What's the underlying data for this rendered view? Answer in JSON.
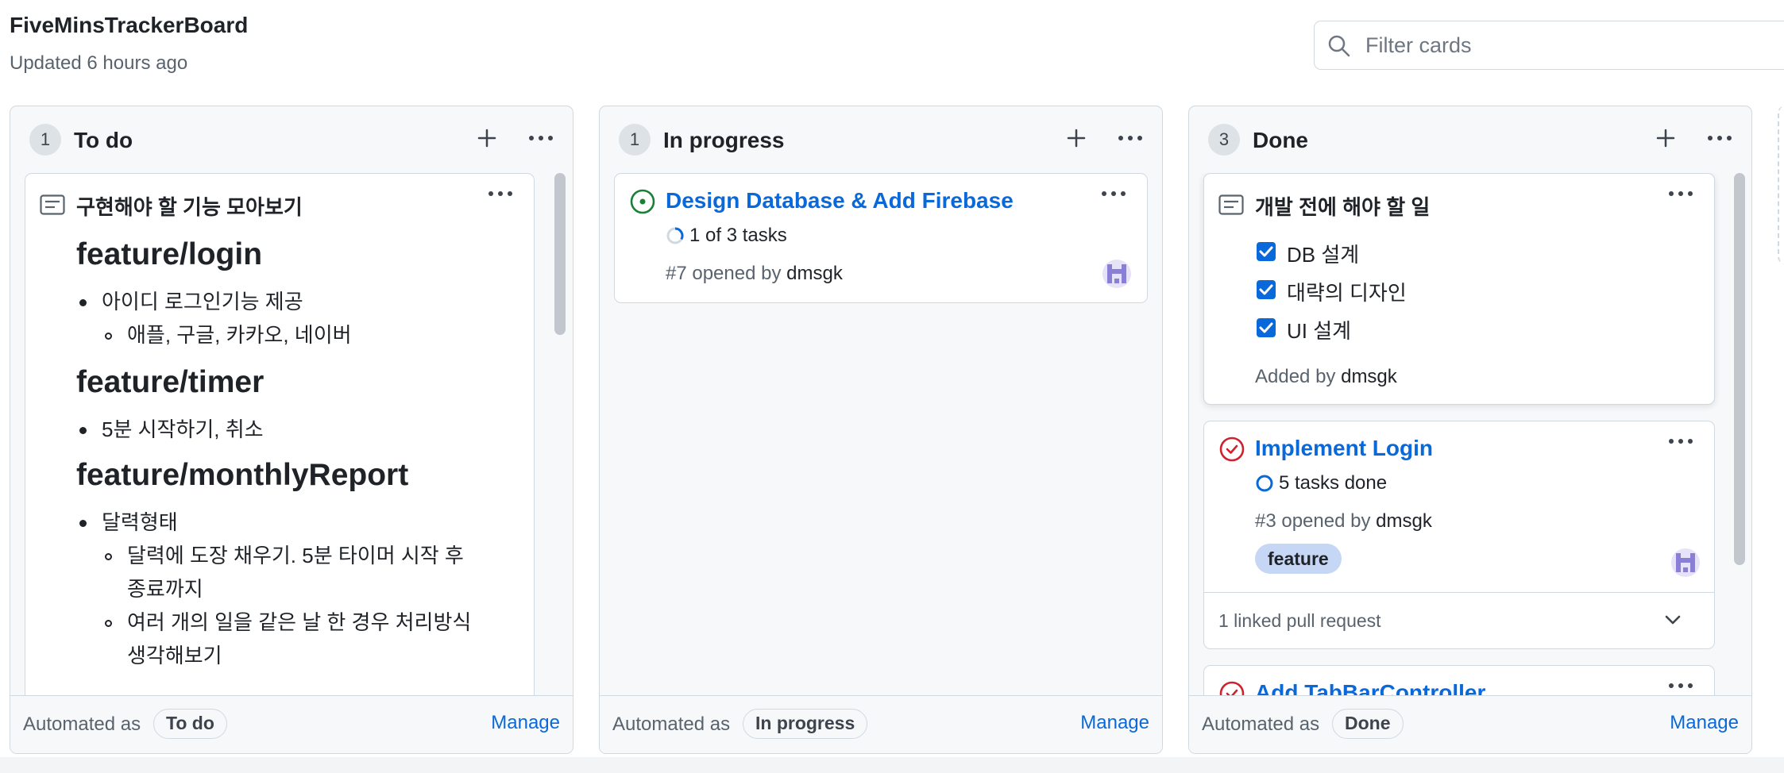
{
  "board": {
    "title": "FiveMinsTrackerBoard",
    "updated": "Updated 6 hours ago",
    "filter_placeholder": "Filter cards"
  },
  "colors": {
    "accent": "#0969da",
    "open_issue": "#1a7f37",
    "closed_issue": "#cf222e",
    "label_feature": "#c5d7f5"
  },
  "columns": [
    {
      "count": "1",
      "title": "To do",
      "automated_label": "Automated as",
      "automated_value": "To do",
      "manage": "Manage",
      "cards": [
        {
          "type": "note",
          "icon": "note-icon",
          "title": "구현해야 할 기능 모아보기",
          "sections": [
            {
              "heading": "feature/login",
              "items": [
                "아이디 로그인기능 제공"
              ],
              "subitems": [
                "애플, 구글, 카카오, 네이버"
              ]
            },
            {
              "heading": "feature/timer",
              "items": [
                "5분 시작하기, 취소"
              ]
            },
            {
              "heading": "feature/monthlyReport",
              "items": [
                "달력형태"
              ],
              "subitems": [
                "달력에 도장 채우기. 5분 타이머 시작 후",
                "종료까지",
                "여러 개의 일을 같은 날 한 경우 처리방식",
                "생각해보기"
              ]
            }
          ]
        }
      ]
    },
    {
      "count": "1",
      "title": "In progress",
      "automated_label": "Automated as",
      "automated_value": "In progress",
      "manage": "Manage",
      "cards": [
        {
          "type": "issue",
          "state": "open",
          "title": "Design Database & Add Firebase",
          "tasks": "1 of 3 tasks",
          "meta": "#7 opened by",
          "author": "dmsgk"
        }
      ]
    },
    {
      "count": "3",
      "title": "Done",
      "automated_label": "Automated as",
      "automated_value": "Done",
      "manage": "Manage",
      "cards": [
        {
          "type": "note",
          "icon": "note-icon",
          "title": "개발 전에 해야 할 일",
          "checklist": [
            "DB 설계",
            "대략의 디자인",
            "UI 설계"
          ],
          "added_by": "Added by",
          "author": "dmsgk"
        },
        {
          "type": "issue",
          "state": "closed",
          "title": "Implement Login",
          "tasks": "5 tasks done",
          "meta": "#3 opened by",
          "author": "dmsgk",
          "label": "feature",
          "linked": "1 linked pull request"
        },
        {
          "type": "issue",
          "state": "closed",
          "title": "Add TabBarController"
        }
      ]
    }
  ]
}
